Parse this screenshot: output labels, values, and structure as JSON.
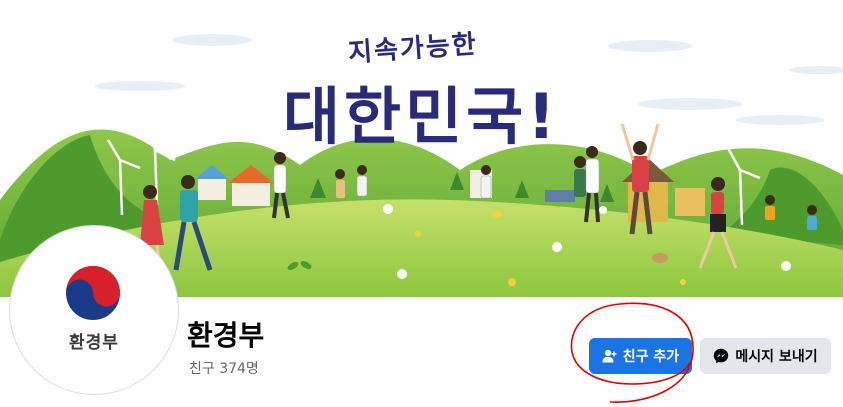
{
  "cover": {
    "headline_small": "지속가능한",
    "headline_large": "대한민국!"
  },
  "profile": {
    "avatar_text": "환경부",
    "name": "환경부",
    "friends": "친구 374명"
  },
  "actions": {
    "add_friend_label": "친구 추가",
    "message_label": "메시지 보내기"
  },
  "colors": {
    "primary_button": "#1b74e4",
    "secondary_button": "#e4e6eb",
    "annotation_circle": "#e00000",
    "hill_green": "#7ab82e",
    "headline_navy": "#2a2a7a"
  }
}
